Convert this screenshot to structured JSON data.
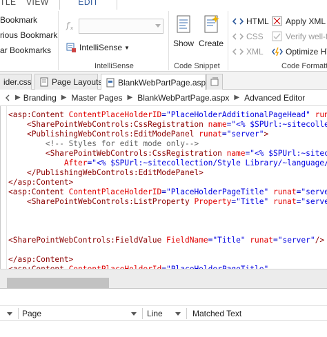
{
  "ribbon_tabs": [
    {
      "label": "TLE"
    },
    {
      "label": "VIEW"
    },
    {
      "label": "EDIT"
    }
  ],
  "ribbon": {
    "bookmarks": {
      "items": [
        {
          "label": "Bookmark"
        },
        {
          "label": "rious Bookmark"
        },
        {
          "label": "ar Bookmarks"
        }
      ]
    },
    "intellisense": {
      "function_combo_value": "",
      "intellisense_button": "IntelliSense",
      "group_label": "IntelliSense"
    },
    "code_snippet": {
      "show_label": "Show",
      "create_label": "Create",
      "group_label": "Code Snippet"
    },
    "code_formatting": {
      "html_label": "HTML",
      "css_label": "CSS",
      "xml_label": "XML",
      "apply_xml_label": "Apply XML",
      "verify_label": "Verify well-f",
      "optimize_label": "Optimize HT",
      "group_label": "Code Formatti"
    }
  },
  "doc_tabs": [
    {
      "label": "ider.css"
    },
    {
      "label": "Page Layouts"
    },
    {
      "label": "BlankWebPartPage.aspx *"
    }
  ],
  "breadcrumb": [
    "Branding",
    "Master Pages",
    "BlankWebPartPage.aspx",
    "Advanced Editor"
  ],
  "code_lines": [
    [
      [
        "t-tag",
        "<asp:Content "
      ],
      [
        "t-attr",
        "ContentPlaceHolderID"
      ],
      [
        "t-op",
        "="
      ],
      [
        "t-val",
        "\"PlaceHolderAdditionalPageHead\""
      ],
      [
        "t-attr",
        " runat"
      ]
    ],
    [
      [
        "t-txt",
        "    "
      ],
      [
        "t-tag",
        "<SharePointWebControls:CssRegistration "
      ],
      [
        "t-attr",
        "name"
      ],
      [
        "t-op",
        "="
      ],
      [
        "t-val",
        "\"<% $SPUrl:~sitecolle"
      ]
    ],
    [
      [
        "t-txt",
        "    "
      ],
      [
        "t-tag",
        "<PublishingWebControls:EditModePanel "
      ],
      [
        "t-attr",
        "runat"
      ],
      [
        "t-op",
        "="
      ],
      [
        "t-val",
        "\"server\""
      ],
      [
        "t-tag",
        ">"
      ]
    ],
    [
      [
        "t-txt",
        "        "
      ],
      [
        "t-com",
        "<!-- Styles for edit mode only-->"
      ]
    ],
    [
      [
        "t-txt",
        "        "
      ],
      [
        "t-tag",
        "<SharePointWebControls:CssRegistration "
      ],
      [
        "t-attr",
        "name"
      ],
      [
        "t-op",
        "="
      ],
      [
        "t-val",
        "\"<% $SPUrl:~sitec"
      ]
    ],
    [
      [
        "t-txt",
        "            "
      ],
      [
        "t-attr",
        "After"
      ],
      [
        "t-op",
        "="
      ],
      [
        "t-val",
        "\"<% $SPUrl:~sitecollection/Style Library/~language/"
      ]
    ],
    [
      [
        "t-txt",
        "    "
      ],
      [
        "t-tag",
        "</PublishingWebControls:EditModePanel>"
      ]
    ],
    [
      [
        "t-tag",
        "</asp:Content>"
      ]
    ],
    [
      [
        "t-tag",
        "<asp:Content "
      ],
      [
        "t-attr",
        "ContentPlaceHolderID"
      ],
      [
        "t-op",
        "="
      ],
      [
        "t-val",
        "\"PlaceHolderPageTitle\""
      ],
      [
        "t-attr",
        " runat"
      ],
      [
        "t-op",
        "="
      ],
      [
        "t-val",
        "\"serve"
      ]
    ],
    [
      [
        "t-txt",
        "    "
      ],
      [
        "t-tag",
        "<SharePointWebControls:ListProperty "
      ],
      [
        "t-attr",
        "Property"
      ],
      [
        "t-op",
        "="
      ],
      [
        "t-val",
        "\"Title\""
      ],
      [
        "t-attr",
        " runat"
      ],
      [
        "t-op",
        "="
      ],
      [
        "t-val",
        "\"serve"
      ]
    ],
    [
      [
        "t-txt",
        ""
      ]
    ],
    [
      [
        "t-txt",
        ""
      ]
    ],
    [
      [
        "t-txt",
        ""
      ]
    ],
    [
      [
        "t-tag",
        "<SharePointWebControls:FieldValue "
      ],
      [
        "t-attr",
        "FieldName"
      ],
      [
        "t-op",
        "="
      ],
      [
        "t-val",
        "\"Title\""
      ],
      [
        "t-attr",
        " runat"
      ],
      [
        "t-op",
        "="
      ],
      [
        "t-val",
        "\"server\""
      ],
      [
        "t-tag",
        "/>"
      ]
    ],
    [
      [
        "t-txt",
        ""
      ]
    ],
    [
      [
        "t-tag",
        "</asp:Content>"
      ]
    ],
    [
      [
        "t-tag",
        "<asp:Content "
      ],
      [
        "t-attr",
        "ContentPlaceHolderId"
      ],
      [
        "t-op",
        "="
      ],
      [
        "t-val",
        "\"PlaceHolderPageTitle\""
      ]
    ]
  ],
  "results": {
    "columns": [
      {
        "label": "Page"
      },
      {
        "label": "Line"
      },
      {
        "label": "Matched Text"
      }
    ]
  },
  "colors": {
    "accent": "#2b579a",
    "tag": "#8b0000",
    "attribute": "#e00000",
    "value": "#0000e0",
    "comment": "#646464"
  }
}
